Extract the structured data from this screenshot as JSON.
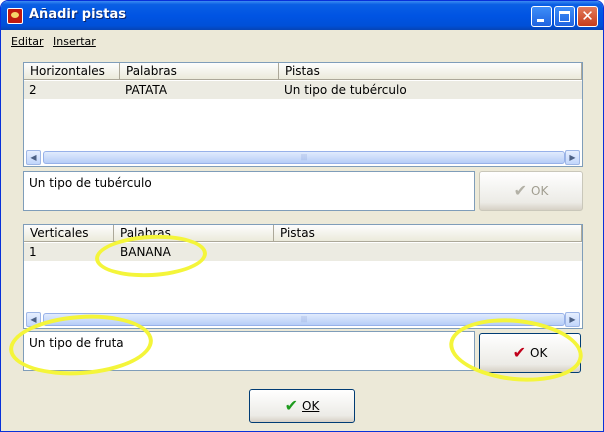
{
  "window": {
    "title": "Añadir pistas"
  },
  "menu": [
    "Editar",
    "Insertar"
  ],
  "horizontal": {
    "headers": [
      "Horizontales",
      "Palabras",
      "Pistas"
    ],
    "rows": [
      {
        "num": "2",
        "word": "PATATA",
        "clue": "Un tipo de tubérculo"
      }
    ],
    "clue_input_value": "Un tipo de tubérculo",
    "ok_label": "OK"
  },
  "vertical": {
    "headers": [
      "Verticales",
      "Palabras",
      "Pistas"
    ],
    "rows": [
      {
        "num": "1",
        "word": "BANANA",
        "clue": ""
      }
    ],
    "clue_input_value": "Un tipo de fruta",
    "ok_label": "OK"
  },
  "footer": {
    "ok_label": "OK"
  },
  "icons": {
    "app": "app-icon",
    "minimize": "minimize-icon",
    "maximize": "maximize-icon",
    "close": "close-icon",
    "scroll_left": "arrow-left-icon",
    "scroll_right": "arrow-right-icon",
    "ok_check": "checkmark-icon"
  },
  "colors": {
    "titlebar": "#0054e3",
    "check_disabled": "#b3b1a6",
    "check_red": "#c0001a",
    "check_green": "#1e9b1e",
    "annotation": "#f4f53a"
  }
}
